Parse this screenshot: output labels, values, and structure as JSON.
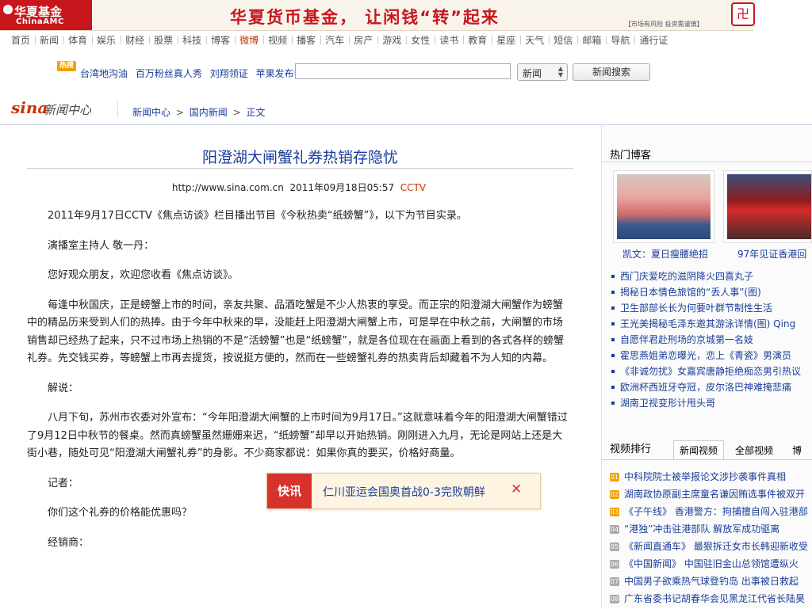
{
  "banner": {
    "logo_cn": "华夏基金",
    "logo_en": "ChinaAMC",
    "slogan": "华夏货币基金，  让闲钱“转”起来",
    "risk_notice": "【市场有风险  投资需谨慎】",
    "emblem": "卍"
  },
  "channel_nav": [
    "首页",
    "新闻",
    "体育",
    "娱乐",
    "财经",
    "股票",
    "科技",
    "博客",
    "微博",
    "视频",
    "播客",
    "汽车",
    "房产",
    "游戏",
    "女性",
    "读书",
    "教育",
    "星座",
    "天气",
    "短信",
    "邮箱",
    "导航",
    "通行证"
  ],
  "channel_nav_active": "微博",
  "search": {
    "hot_badge": "热搜",
    "hot_links": [
      "台湾地沟油",
      "百万粉丝真人秀",
      "刘翔领证",
      "苹果发布会"
    ],
    "input_value": "",
    "select_value": "新闻",
    "button_label": "新闻搜索"
  },
  "header": {
    "logo_brand": "sina",
    "logo_section": "新闻中心",
    "breadcrumb": [
      "新闻中心",
      "国内新闻",
      "正文"
    ],
    "breadcrumb_sep": ">"
  },
  "article": {
    "title": "阳澄湖大闸蟹礼券热销存隐忧",
    "meta": {
      "url": "http://www.sina.com.cn",
      "datetime": "2011年09月18日05:57",
      "source": "CCTV"
    },
    "paragraphs": [
      "2011年9月17日CCTV《焦点访谈》栏目播出节目《今秋热卖“纸螃蟹”》，以下为节目实录。",
      "演播室主持人 敬一丹：",
      "您好观众朋友，欢迎您收看《焦点访谈》。",
      "每逢中秋国庆，正是螃蟹上市的时间，亲友共聚、品酒吃蟹是不少人热衷的享受。而正宗的阳澄湖大闸蟹作为螃蟹中的精品历来受到人们的热捧。由于今年中秋来的早，没能赶上阳澄湖大闸蟹上市，可是早在中秋之前，大闸蟹的市场销售却已经热了起来，只不过市场上热销的不是“活螃蟹”也是“纸螃蟹”，就是各位现在在画面上看到的各式各样的螃蟹礼券。先交钱买券，等螃蟹上市再去提货，按说挺方便的，然而在一些螃蟹礼券的热卖背后却藏着不为人知的内幕。",
      "解说：",
      "八月下旬，苏州市农委对外宣布：“今年阳澄湖大闸蟹的上市时间为9月17日。”这就意味着今年的阳澄湖大闸蟹错过了9月12日中秋节的餐桌。然而真螃蟹虽然姗姗来迟，“纸螃蟹”却早以开始热销。刚刚进入九月，无论是网站上还是大街小巷，随处可见“阳澄湖大闸蟹礼券”的身影。不少商家都说：如果你真的要买，价格好商量。",
      "记者：",
      "你们这个礼券的价格能优惠吗？",
      "经销商："
    ]
  },
  "sidebar": {
    "blog_header": "热门博客",
    "blog_cards": [
      {
        "caption": "凯文：夏日瘦腰绝招"
      },
      {
        "caption": "97年见证香港回"
      }
    ],
    "blog_links": [
      "西门庆爱吃的滋阴降火四喜丸子",
      "揭秘日本情色旅馆的“丢人事”(图)",
      "卫生部部长长为何要叶群节制性生活",
      "王光美揭秘毛泽东邀其游泳详情(图) Qing",
      "自愿伴君赴刑场的京城第一名妓",
      "霍思燕姐弟恋曝光，恋上《青瓷》男演员",
      "《非诚勿扰》女嘉宾唐静拒绝痴恋男引热议",
      "欧洲杯西班牙夺冠，皮尔洛巴神难掩悲痛",
      "湖南卫视变形计甩头哥"
    ],
    "video": {
      "label": "视频排行",
      "tabs": [
        "新闻视频",
        "全部视频",
        "博"
      ],
      "items": [
        {
          "rank": "01",
          "title": "中科院院士被举报论文涉抄袭事件真相"
        },
        {
          "rank": "02",
          "title": "湖南政协原副主席童名谦因贿选事件被双开"
        },
        {
          "rank": "03",
          "title": "《子午线》 香港警方：拘捕擅自闯入驻港部"
        },
        {
          "rank": "04",
          "title": "“港独”冲击驻港部队 解放军成功驱离"
        },
        {
          "rank": "05",
          "title": "《新闻直通车》 最狠拆迁女市长韩迎新收受"
        },
        {
          "rank": "06",
          "title": "《中国新闻》 中国驻旧金山总领馆遭纵火"
        },
        {
          "rank": "07",
          "title": "中国男子欲乘热气球登钓岛 出事被日救起"
        },
        {
          "rank": "08",
          "title": "广东省委书记胡春华会见黑龙江代省长陆昊"
        }
      ]
    }
  },
  "news_flash": {
    "label": "快讯",
    "text": "仁川亚运会国奥首战0-3完败朝鲜",
    "close": "✕"
  }
}
